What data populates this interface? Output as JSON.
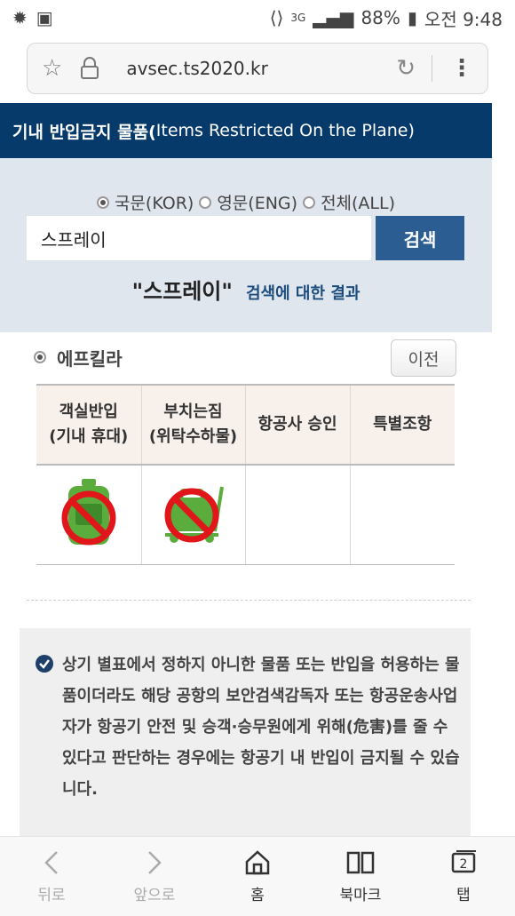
{
  "status_bar": {
    "battery": "88%",
    "time": "오전 9:48",
    "network": "3G"
  },
  "browser": {
    "url": "avsec.ts2020.kr"
  },
  "header": {
    "title_ko": "기내 반입금지 물품(",
    "title_en": "Items Restricted On the Plane)"
  },
  "search": {
    "radios": [
      {
        "label": "국문(KOR)",
        "checked": true
      },
      {
        "label": "영문(ENG)",
        "checked": false
      },
      {
        "label": "전체(ALL)",
        "checked": false
      }
    ],
    "query": "스프레이",
    "button_label": "검색",
    "result_term": "\"스프레이\"",
    "result_suffix": "검색에 대한 결과"
  },
  "item": {
    "name": "에프킬라",
    "prev_label": "이전"
  },
  "table": {
    "headers": [
      [
        "객실반입",
        "(기내 휴대)"
      ],
      [
        "부치는짐",
        "(위탁수하물)"
      ],
      [
        "항공사 승인"
      ],
      [
        "특별조항"
      ]
    ]
  },
  "notice": {
    "text": "상기 별표에서 정하지 아니한 물품 또는 반입을 허용하는 물품이더라도 해당 공항의 보안검색감독자 또는 항공운송사업자가 항공기 안전 및 승객·승무원에게 위해(危害)를 줄 수 있다고 판단하는 경우에는 항공기 내 반입이 금지될 수 있습니다."
  },
  "bottom_nav": [
    {
      "label": "뒤로",
      "icon": "back-icon"
    },
    {
      "label": "앞으로",
      "icon": "forward-icon"
    },
    {
      "label": "홈",
      "icon": "home-icon"
    },
    {
      "label": "북마크",
      "icon": "bookmark-icon"
    },
    {
      "label": "탭",
      "icon": "tabs-icon",
      "count": "2"
    }
  ]
}
